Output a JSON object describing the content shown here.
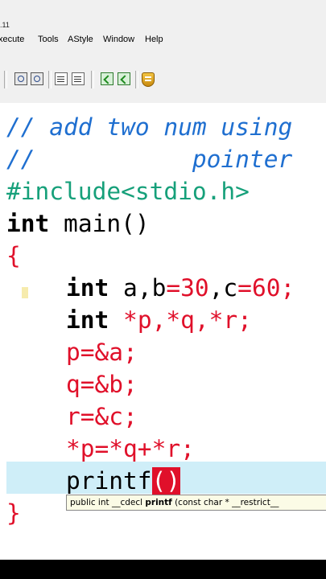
{
  "title_fragment": ".11",
  "menu": [
    "xecute",
    "Tools",
    "AStyle",
    "Window",
    "Help"
  ],
  "toolbar_icons": [
    "find-icon",
    "find-next-icon",
    "indent-icon",
    "unindent-icon",
    "goto-icon",
    "back-icon",
    "ide-shield-icon"
  ],
  "editor": {
    "lines": [
      {
        "kind": "comment",
        "text": "// add two num using"
      },
      {
        "kind": "comment",
        "text": "//           pointer"
      },
      {
        "kind": "preproc",
        "text": "#include<stdio.h>"
      },
      {
        "kind": "code",
        "t1": "int",
        "t2": " main()"
      },
      {
        "kind": "brace",
        "text": "{"
      },
      {
        "kind": "decl1",
        "kw": "int",
        "a": " a,b",
        "op1": "=",
        "n1": "30",
        "c": ",c",
        "op2": "=",
        "n2": "60",
        "semi": ";"
      },
      {
        "kind": "decl2",
        "kw": "int",
        "rest": " *p,*q,*r;"
      },
      {
        "kind": "stmt",
        "text": "p=&a;"
      },
      {
        "kind": "stmt",
        "text": "q=&b;"
      },
      {
        "kind": "stmt",
        "text": "r=&c;"
      },
      {
        "kind": "stmt",
        "text": "*p=*q+*r;"
      },
      {
        "kind": "printf",
        "name": "printf",
        "paren": "()"
      },
      {
        "kind": "brace",
        "text": "}"
      }
    ],
    "hint": {
      "pre": "public int __cdecl ",
      "fn": "printf",
      "post": " (const char * __restrict__"
    }
  }
}
